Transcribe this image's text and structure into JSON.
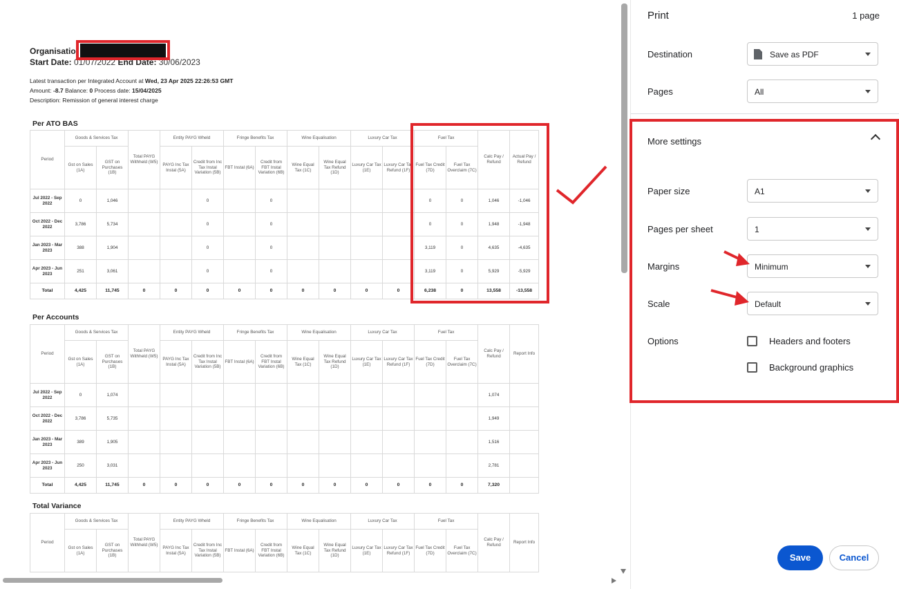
{
  "document": {
    "org_label": "Organisatio",
    "start_label": "Start Date:",
    "start_value": "01/07/2022",
    "end_label": "End Date:",
    "end_value": "30/06/2023",
    "latest_prefix": "Latest transaction per Integrated Account at",
    "latest_value": "Wed, 23 Apr 2025 22:26:53 GMT",
    "amount_label": "Amount:",
    "amount_value": "-8.7",
    "balance_label": "Balance:",
    "balance_value": "0",
    "process_label": "Process date:",
    "process_value": "15/04/2025",
    "description": "Description: Remission of general interest charge",
    "groups": [
      "Goods & Services Tax",
      "Entity PAYG Wheld",
      "Fringe Benefits Tax",
      "Wine Equalisation",
      "Luxury Car Tax",
      "Fuel Tax"
    ],
    "columns": {
      "period": "Period",
      "gst_sales": "Gst on Sales (1A)",
      "gst_purchases": "GST on Purchases (1B)",
      "total_payg": "Total PAYG Withheld (W5)",
      "payg_inc": "PAYG Inc Tax Instal (5A)",
      "credit_inc": "Credit from Inc Tax Instal Variation (5B)",
      "fbt_instal": "FBT Instal (6A)",
      "credit_fbt": "Credit from FBT Instal Variation (6B)",
      "wine_equal": "Wine Equal Tax (1C)",
      "wine_refund": "Wine Equal Tax Refund (1D)",
      "luxury_tax": "Luxury Car Tax (1E)",
      "luxury_refund": "Luxury Car Tax Refund (1F)",
      "fuel_credit": "Fuel Tax Credit (7D)",
      "fuel_overclaim": "Fuel Tax Overclaim (7C)",
      "calc_pay": "Calc Pay / Refund",
      "actual_pay": "Actual Pay / Refund",
      "report_info": "Report Info"
    },
    "sections": {
      "ato": "Per ATO BAS",
      "accounts": "Per Accounts",
      "variance": "Total Variance"
    },
    "ato_rows": [
      [
        "Jul 2022 - Sep 2022",
        "0",
        "1,046",
        "",
        "",
        "0",
        "",
        "0",
        "",
        "",
        "",
        "",
        "0",
        "0",
        "1,046",
        "-1,046"
      ],
      [
        "Oct 2022 - Dec 2022",
        "3,786",
        "5,734",
        "",
        "",
        "0",
        "",
        "0",
        "",
        "",
        "",
        "",
        "0",
        "0",
        "1,948",
        "-1,948"
      ],
      [
        "Jan 2023 - Mar 2023",
        "388",
        "1,904",
        "",
        "",
        "0",
        "",
        "0",
        "",
        "",
        "",
        "",
        "3,119",
        "0",
        "4,635",
        "-4,635"
      ],
      [
        "Apr 2023 - Jun 2023",
        "251",
        "3,061",
        "",
        "",
        "0",
        "",
        "0",
        "",
        "",
        "",
        "",
        "3,119",
        "0",
        "5,929",
        "-5,929"
      ],
      [
        "Total",
        "4,425",
        "11,745",
        "0",
        "0",
        "0",
        "0",
        "0",
        "0",
        "0",
        "0",
        "0",
        "6,238",
        "0",
        "13,558",
        "-13,558"
      ]
    ],
    "acc_rows": [
      [
        "Jul 2022 - Sep 2022",
        "0",
        "1,074",
        "",
        "",
        "",
        "",
        "",
        "",
        "",
        "",
        "",
        "",
        "",
        "1,074",
        ""
      ],
      [
        "Oct 2022 - Dec 2022",
        "3,786",
        "5,735",
        "",
        "",
        "",
        "",
        "",
        "",
        "",
        "",
        "",
        "",
        "",
        "1,949",
        ""
      ],
      [
        "Jan 2023 - Mar 2023",
        "389",
        "1,905",
        "",
        "",
        "",
        "",
        "",
        "",
        "",
        "",
        "",
        "",
        "",
        "1,516",
        ""
      ],
      [
        "Apr 2023 - Jun 2023",
        "250",
        "3,031",
        "",
        "",
        "",
        "",
        "",
        "",
        "",
        "",
        "",
        "",
        "",
        "2,781",
        ""
      ],
      [
        "Total",
        "4,425",
        "11,745",
        "0",
        "0",
        "0",
        "0",
        "0",
        "0",
        "0",
        "0",
        "0",
        "0",
        "0",
        "7,320",
        ""
      ]
    ]
  },
  "panel": {
    "title": "Print",
    "page_count": "1 page",
    "destination_label": "Destination",
    "destination_value": "Save as PDF",
    "pages_label": "Pages",
    "pages_value": "All",
    "more_settings": "More settings",
    "paper_size_label": "Paper size",
    "paper_size_value": "A1",
    "pages_per_sheet_label": "Pages per sheet",
    "pages_per_sheet_value": "1",
    "margins_label": "Margins",
    "margins_value": "Minimum",
    "scale_label": "Scale",
    "scale_value": "Default",
    "options_label": "Options",
    "headers_footers": "Headers and footers",
    "background_graphics": "Background graphics",
    "save": "Save",
    "cancel": "Cancel"
  },
  "colors": {
    "annotation_red": "#e0262b",
    "primary_blue": "#0b57d0"
  }
}
